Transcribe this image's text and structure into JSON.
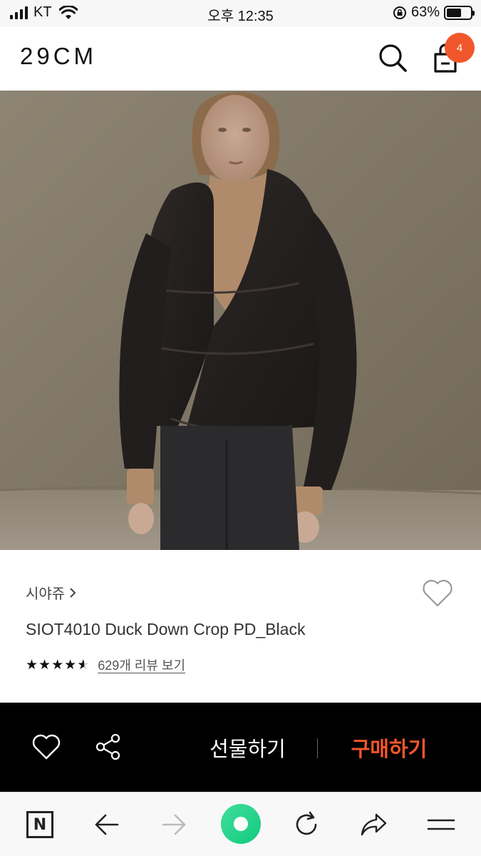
{
  "status_bar": {
    "carrier": "KT",
    "time": "오후 12:35",
    "battery_percent": "63%",
    "battery_level": 0.63,
    "icons": [
      "signal-icon",
      "wifi-icon",
      "rotation-lock-icon",
      "battery-icon"
    ]
  },
  "header": {
    "logo": "29CM",
    "cart_count": "4",
    "icons": [
      "search-icon",
      "shopping-bag-icon"
    ]
  },
  "product": {
    "image_alt": "Model wearing black cropped puffer jacket with camel turtleneck",
    "brand": "시야쥬",
    "brand_chevron": "›",
    "title": "SIOT4010 Duck Down Crop PD_Black",
    "rating_value": 4.5,
    "review_link": "629개 리뷰 보기"
  },
  "buy_bar": {
    "gift_label": "선물하기",
    "buy_label": "구매하기",
    "icons": [
      "heart-icon",
      "share-icon"
    ]
  },
  "browser_toolbar": {
    "home_label": "N",
    "icons": [
      "naver-home-icon",
      "back-arrow-icon",
      "forward-arrow-icon",
      "green-dot-icon",
      "refresh-icon",
      "share-arrow-icon",
      "menu-icon"
    ]
  },
  "colors": {
    "accent": "#f2562b",
    "buy_bar_bg": "#000000",
    "green": "#1ecf86"
  }
}
